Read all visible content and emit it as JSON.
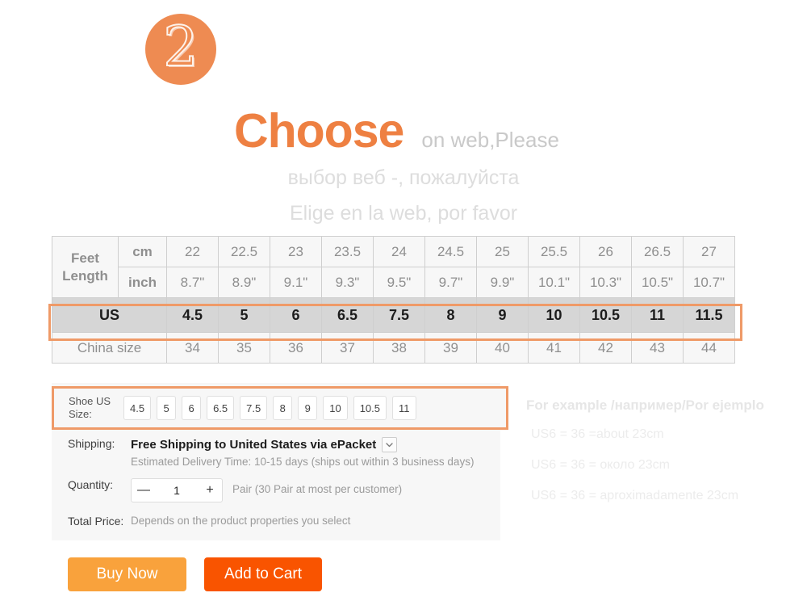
{
  "header": {
    "step_number": "2",
    "title": "Choose",
    "title_suffix": "on web,Please",
    "subtitle_ru": "выбор веб -, пожалуйста",
    "subtitle_es": "Elige en la web, por favor"
  },
  "size_table": {
    "feet_length_label": "Feet Length",
    "cm_label": "cm",
    "inch_label": "inch",
    "us_label": "US",
    "china_label": "China size",
    "cm": [
      "22",
      "22.5",
      "23",
      "23.5",
      "24",
      "24.5",
      "25",
      "25.5",
      "26",
      "26.5",
      "27"
    ],
    "inch": [
      "8.7\"",
      "8.9\"",
      "9.1\"",
      "9.3\"",
      "9.5\"",
      "9.7\"",
      "9.9\"",
      "10.1\"",
      "10.3\"",
      "10.5\"",
      "10.7\""
    ],
    "us": [
      "4.5",
      "5",
      "6",
      "6.5",
      "7.5",
      "8",
      "9",
      "10",
      "10.5",
      "11",
      "11.5"
    ],
    "china": [
      "34",
      "35",
      "36",
      "37",
      "38",
      "39",
      "40",
      "41",
      "42",
      "43",
      "44"
    ]
  },
  "form": {
    "shoe_size_label": "Shoe US Size:",
    "shoe_size_options": [
      "4.5",
      "5",
      "6",
      "6.5",
      "7.5",
      "8",
      "9",
      "10",
      "10.5",
      "11"
    ],
    "shipping_label": "Shipping:",
    "shipping_value": "Free Shipping to United States via ePacket",
    "shipping_note": "Estimated Delivery Time: 10-15 days (ships out within 3  business days)",
    "quantity_label": "Quantity:",
    "quantity_value": "1",
    "quantity_minus": "—",
    "quantity_plus": "+",
    "quantity_note": "Pair (30 Pair at most per customer)",
    "total_price_label": "Total Price:",
    "total_price_value": "Depends on the product properties you select"
  },
  "example": {
    "title": "For example /например/Por ejemplo",
    "lines": [
      "US6 = 36 =about 23cm",
      "US6 = 36 = около 23cm",
      "US6 = 36 = aproximadamente 23cm"
    ]
  },
  "buttons": {
    "buy_now": "Buy Now",
    "add_to_cart": "Add to Cart"
  },
  "colors": {
    "accent_orange": "#ee8042",
    "highlight_border": "#ef9a68",
    "buy_now_bg": "#f9a23c",
    "add_to_cart_bg": "#f95400",
    "us_row_bg": "#d6d6d6",
    "panel_bg": "#f7f7f7"
  }
}
